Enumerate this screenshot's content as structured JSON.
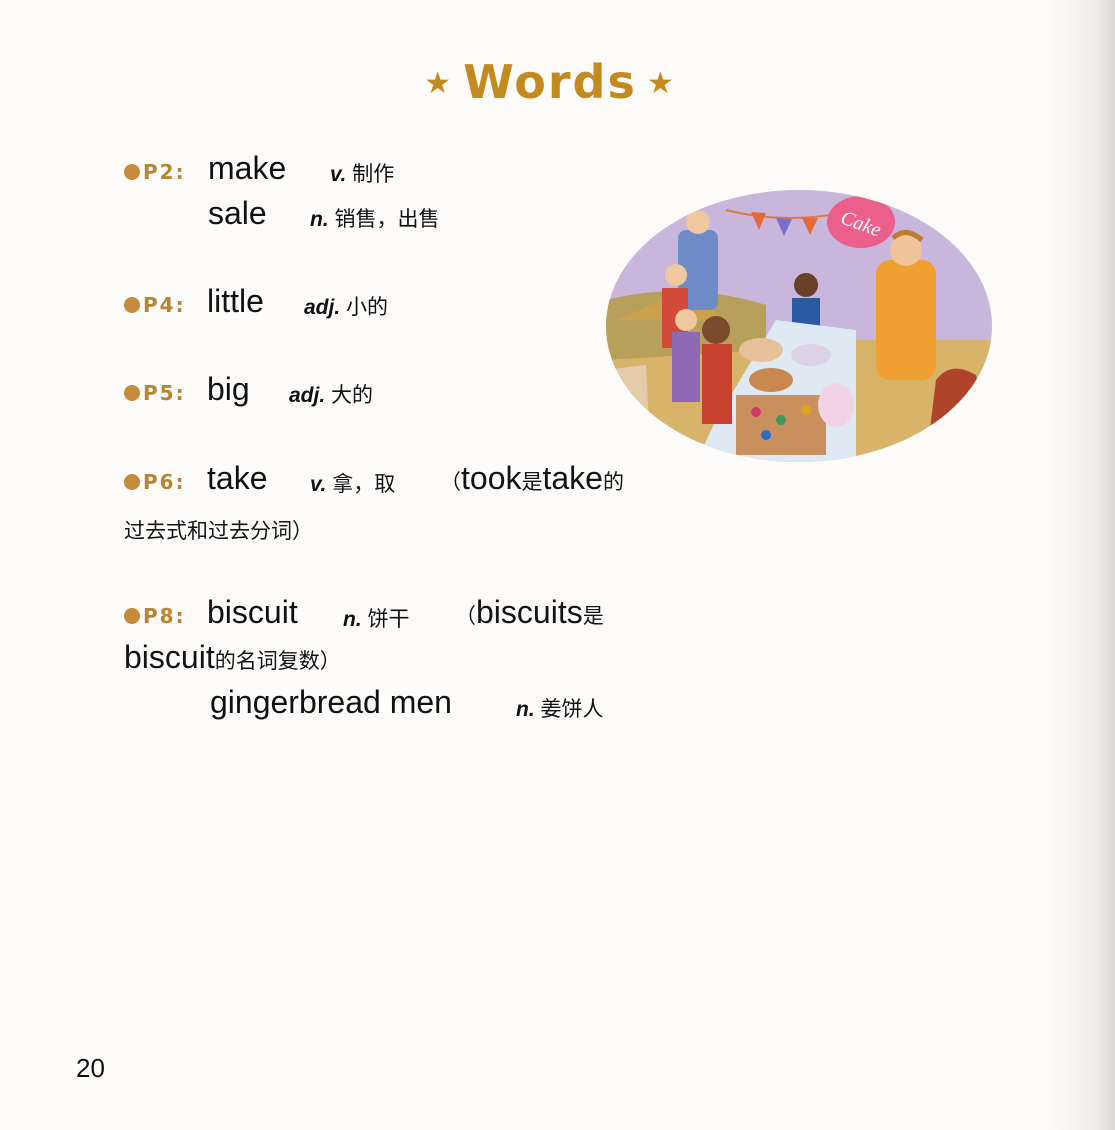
{
  "title": "Words",
  "icons": {
    "title_star": "star-icon",
    "bullet": "bullet-dot-icon"
  },
  "colors": {
    "accent": "#c58a1e",
    "bullet": "#c58a3a",
    "text": "#141414"
  },
  "entries": [
    {
      "page": "P2:",
      "word": "make",
      "pos": "v.",
      "meaning": "制作"
    },
    {
      "word": "sale",
      "pos": "n.",
      "meaning": "销售，出售"
    },
    {
      "page": "P4:",
      "word": "little",
      "pos": "adj.",
      "meaning": "小的"
    },
    {
      "page": "P5:",
      "word": "big",
      "pos": "adj.",
      "meaning": "大的"
    },
    {
      "page": "P6:",
      "word": "take",
      "pos": "v.",
      "meaning": "拿，取",
      "note": {
        "open": "（",
        "w1": "took",
        "t1": "是",
        "w2": "take",
        "t2": "的",
        "line2": "过去式和过去分词）"
      }
    },
    {
      "page": "P8:",
      "word": "biscuit",
      "pos": "n.",
      "meaning": "饼干",
      "note": {
        "open": "（",
        "w1": "biscuits",
        "t1": "是",
        "w2": "biscuit",
        "t2": "的名词复数）"
      }
    },
    {
      "word": "gingerbread men",
      "pos": "n.",
      "meaning": "姜饼人"
    }
  ],
  "illustration": {
    "banner_text": "Cake"
  },
  "page_number": "20"
}
